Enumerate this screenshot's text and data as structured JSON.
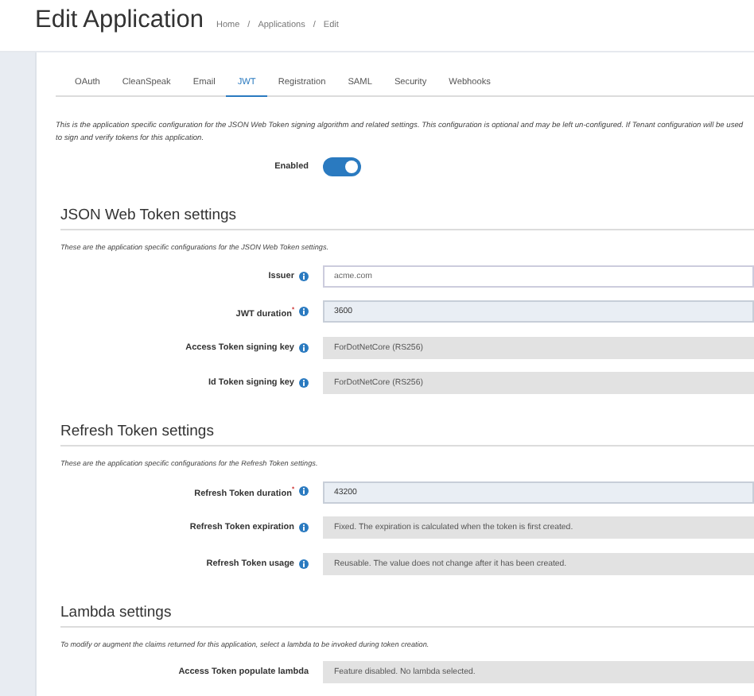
{
  "page": {
    "title": "Edit Application"
  },
  "breadcrumb": [
    "Home",
    "Applications",
    "Edit"
  ],
  "breadcrumb_separator": "/",
  "tabs": [
    {
      "label": "OAuth",
      "selected": false
    },
    {
      "label": "CleanSpeak",
      "selected": false
    },
    {
      "label": "Email",
      "selected": false
    },
    {
      "label": "JWT",
      "selected": true
    },
    {
      "label": "Registration",
      "selected": false
    },
    {
      "label": "SAML",
      "selected": false
    },
    {
      "label": "Security",
      "selected": false
    },
    {
      "label": "Webhooks",
      "selected": false
    }
  ],
  "intro": "This is the application specific configuration for the JSON Web Token signing algorithm and related settings. This configuration is optional and may be left un-configured. If Tenant configuration will be used to sign and verify tokens for this application.",
  "enabled": {
    "label": "Enabled",
    "on": true
  },
  "sections": [
    {
      "heading": "JSON Web Token settings",
      "description": "These are the application specific configurations for the JSON Web Token settings.",
      "fields": [
        {
          "label": "Issuer",
          "info": true,
          "kind": "text",
          "value": "acme.com"
        },
        {
          "label": "JWT duration$^{*}$",
          "info": true,
          "kind": "number",
          "value": "3600"
        },
        {
          "label": "Access Token signing key",
          "info": true,
          "kind": "readonly",
          "value": "ForDotNetCore (RS256)"
        },
        {
          "label": "Id Token signing key",
          "info": true,
          "kind": "readonly",
          "value": "ForDotNetCore (RS256)"
        }
      ]
    },
    {
      "heading": "Refresh Token settings",
      "description": "These are the application specific configurations for the Refresh Token settings.",
      "fields": [
        {
          "label": "Refresh Token duration$^{*}$",
          "info": true,
          "kind": "number",
          "value": "43200"
        },
        {
          "label": "Refresh Token expiration",
          "info": true,
          "kind": "readonly",
          "value": "Fixed. The expiration is calculated when the token is first created."
        },
        {
          "label": "Refresh Token usage",
          "info": true,
          "kind": "readonly",
          "value": "Reusable. The value does not change after it has been created."
        }
      ]
    },
    {
      "heading": "Lambda settings",
      "description": "To modify or augment the claims returned for this application, select a lambda to be invoked during token creation.",
      "fields": [
        {
          "label": "Access Token populate lambda",
          "info": false,
          "kind": "readonly",
          "value": "Feature disabled. No lambda selected."
        }
      ]
    }
  ]
}
